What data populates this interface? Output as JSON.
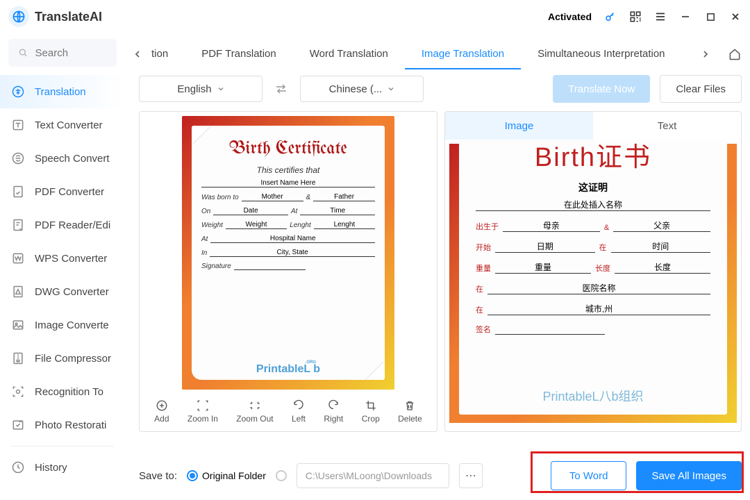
{
  "app": {
    "name": "TranslateAI",
    "status": "Activated"
  },
  "search": {
    "placeholder": "Search"
  },
  "sidebar": {
    "items": [
      {
        "label": "Translation"
      },
      {
        "label": "Text Converter"
      },
      {
        "label": "Speech Convert"
      },
      {
        "label": "PDF Converter"
      },
      {
        "label": "PDF Reader/Edi"
      },
      {
        "label": "WPS Converter"
      },
      {
        "label": "DWG Converter"
      },
      {
        "label": "Image Converte"
      },
      {
        "label": "File Compressor"
      },
      {
        "label": "Recognition To"
      },
      {
        "label": "Photo Restorati"
      }
    ],
    "history": "History"
  },
  "tabs": {
    "partial": "tion",
    "items": [
      {
        "label": "PDF Translation"
      },
      {
        "label": "Word Translation"
      },
      {
        "label": "Image Translation"
      },
      {
        "label": "Simultaneous Interpretation"
      }
    ]
  },
  "lang": {
    "source": "English",
    "target": "Chinese (...",
    "translate": "Translate Now",
    "clear": "Clear Files"
  },
  "tools": {
    "add": "Add",
    "zoomin": "Zoom In",
    "zoomout": "Zoom Out",
    "left": "Left",
    "right": "Right",
    "crop": "Crop",
    "delete": "Delete"
  },
  "result_tabs": {
    "image": "Image",
    "text": "Text"
  },
  "cert_en": {
    "title": "Birth Certificate",
    "sub": "This certifies that",
    "name_ph": "Insert Name Here",
    "born": "Was born to",
    "mother": "Mother",
    "amp": "&",
    "father": "Father",
    "on": "On",
    "date": "Date",
    "at": "At",
    "time": "Time",
    "weight": "Weight",
    "weight_v": "Weight",
    "len": "Lenght",
    "len_v": "Lenght",
    "at2": "At",
    "hosp": "Hospital Name",
    "in": "In",
    "city": "City, State",
    "sig": "Signature",
    "brand": "PrintableL  b"
  },
  "cert_cn": {
    "title": "Birth证书",
    "sub": "这证明",
    "name_ph": "在此处插入名称",
    "born": "出生于",
    "mother": "母亲",
    "amp": "&",
    "father": "父亲",
    "on": "开始",
    "date": "日期",
    "at": "在",
    "time": "时间",
    "weight": "重量",
    "weight_v": "重量",
    "len": "长度",
    "len_v": "长度",
    "at2": "在",
    "hosp": "医院名称",
    "in": "在",
    "city": "城市,州",
    "sig": "签名",
    "brand": "PrintableL八b组织"
  },
  "save": {
    "label": "Save to:",
    "orig": "Original Folder",
    "path": "C:\\Users\\MLoong\\Downloads",
    "to_word": "To Word",
    "save_all": "Save All Images"
  }
}
